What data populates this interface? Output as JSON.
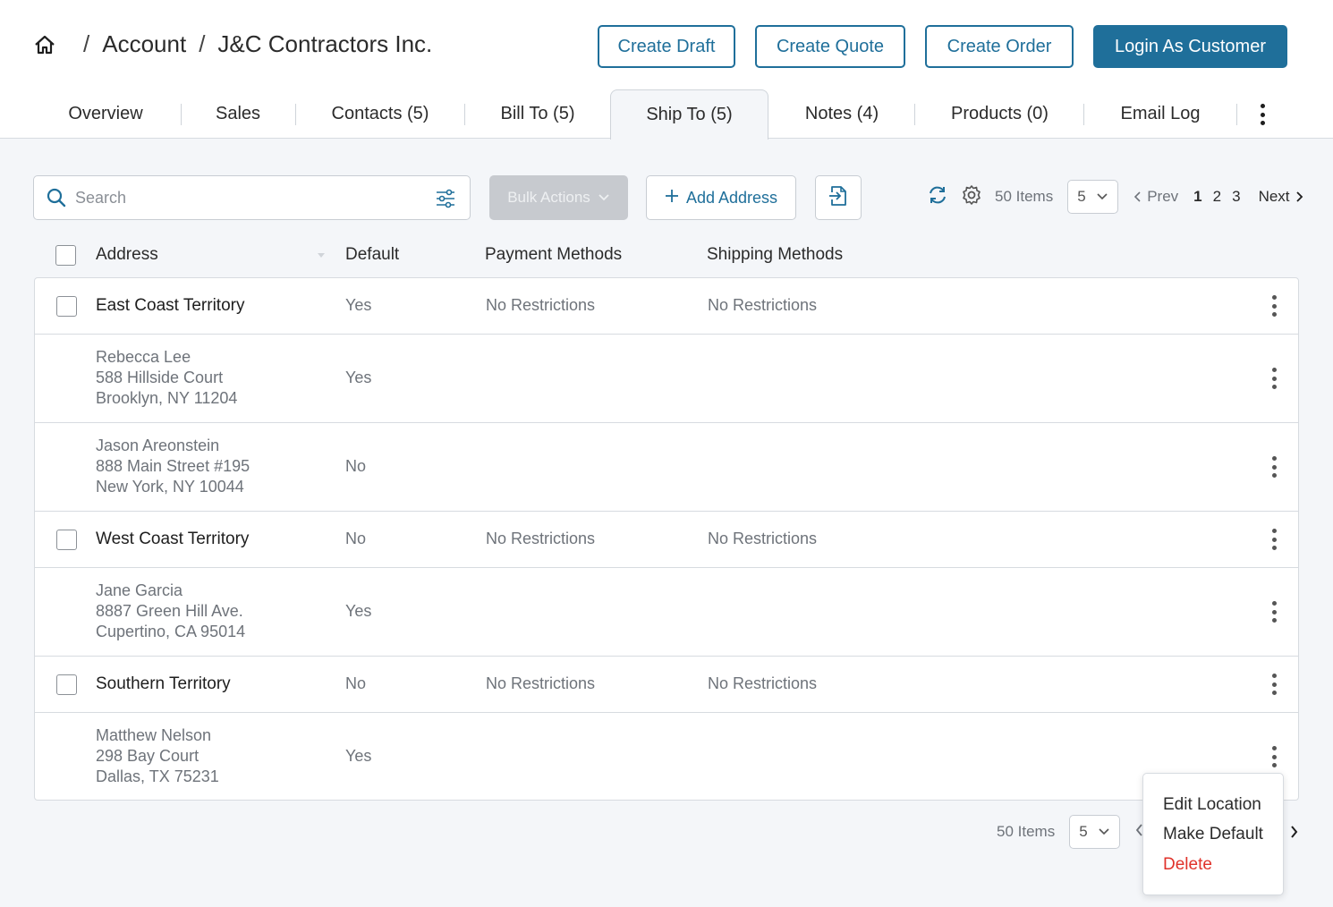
{
  "breadcrumb": {
    "account": "Account",
    "customer": "J&C Contractors Inc.",
    "separator": "/"
  },
  "header_buttons": {
    "create_draft": "Create Draft",
    "create_quote": "Create Quote",
    "create_order": "Create Order",
    "login_as_customer": "Login As Customer"
  },
  "tabs": [
    {
      "label": "Overview"
    },
    {
      "label": "Sales"
    },
    {
      "label": "Contacts (5)"
    },
    {
      "label": "Bill To (5)"
    },
    {
      "label": "Ship To (5)",
      "active": true
    },
    {
      "label": "Notes (4)"
    },
    {
      "label": "Products (0)"
    },
    {
      "label": "Email Log"
    }
  ],
  "toolbar": {
    "search_placeholder": "Search",
    "bulk_actions": "Bulk Actions",
    "add_address": "Add Address",
    "items_count": "50 Items",
    "per_page": "5",
    "prev": "Prev",
    "next": "Next",
    "pages": [
      "1",
      "2",
      "3"
    ],
    "current_page": "1"
  },
  "table": {
    "columns": {
      "address": "Address",
      "default": "Default",
      "payment": "Payment Methods",
      "shipping": "Shipping Methods"
    },
    "rows": [
      {
        "type": "group",
        "address": "East Coast Territory",
        "default": "Yes",
        "payment": "No Restrictions",
        "shipping": "No Restrictions"
      },
      {
        "type": "contact",
        "name": "Rebecca Lee",
        "street": "588 Hillside Court",
        "city": "Brooklyn, NY 11204",
        "default": "Yes"
      },
      {
        "type": "contact",
        "name": "Jason Areonstein",
        "street": "888 Main Street #195",
        "city": "New York, NY 10044",
        "default": "No"
      },
      {
        "type": "group",
        "address": "West Coast Territory",
        "default": "No",
        "payment": "No Restrictions",
        "shipping": "No Restrictions"
      },
      {
        "type": "contact",
        "name": "Jane Garcia",
        "street": "8887 Green Hill Ave.",
        "city": "Cupertino, CA 95014",
        "default": "Yes"
      },
      {
        "type": "group",
        "address": "Southern Territory",
        "default": "No",
        "payment": "No Restrictions",
        "shipping": "No Restrictions"
      },
      {
        "type": "contact",
        "name": "Matthew Nelson",
        "street": "298 Bay Court",
        "city": "Dallas, TX 75231",
        "default": "Yes"
      }
    ]
  },
  "footer": {
    "items_count": "50 Items",
    "per_page": "5"
  },
  "context_menu": {
    "edit": "Edit Location",
    "make_default": "Make Default",
    "delete": "Delete"
  },
  "colors": {
    "primary": "#1f6f9a",
    "danger": "#e0322a",
    "background": "#f4f6f9"
  }
}
